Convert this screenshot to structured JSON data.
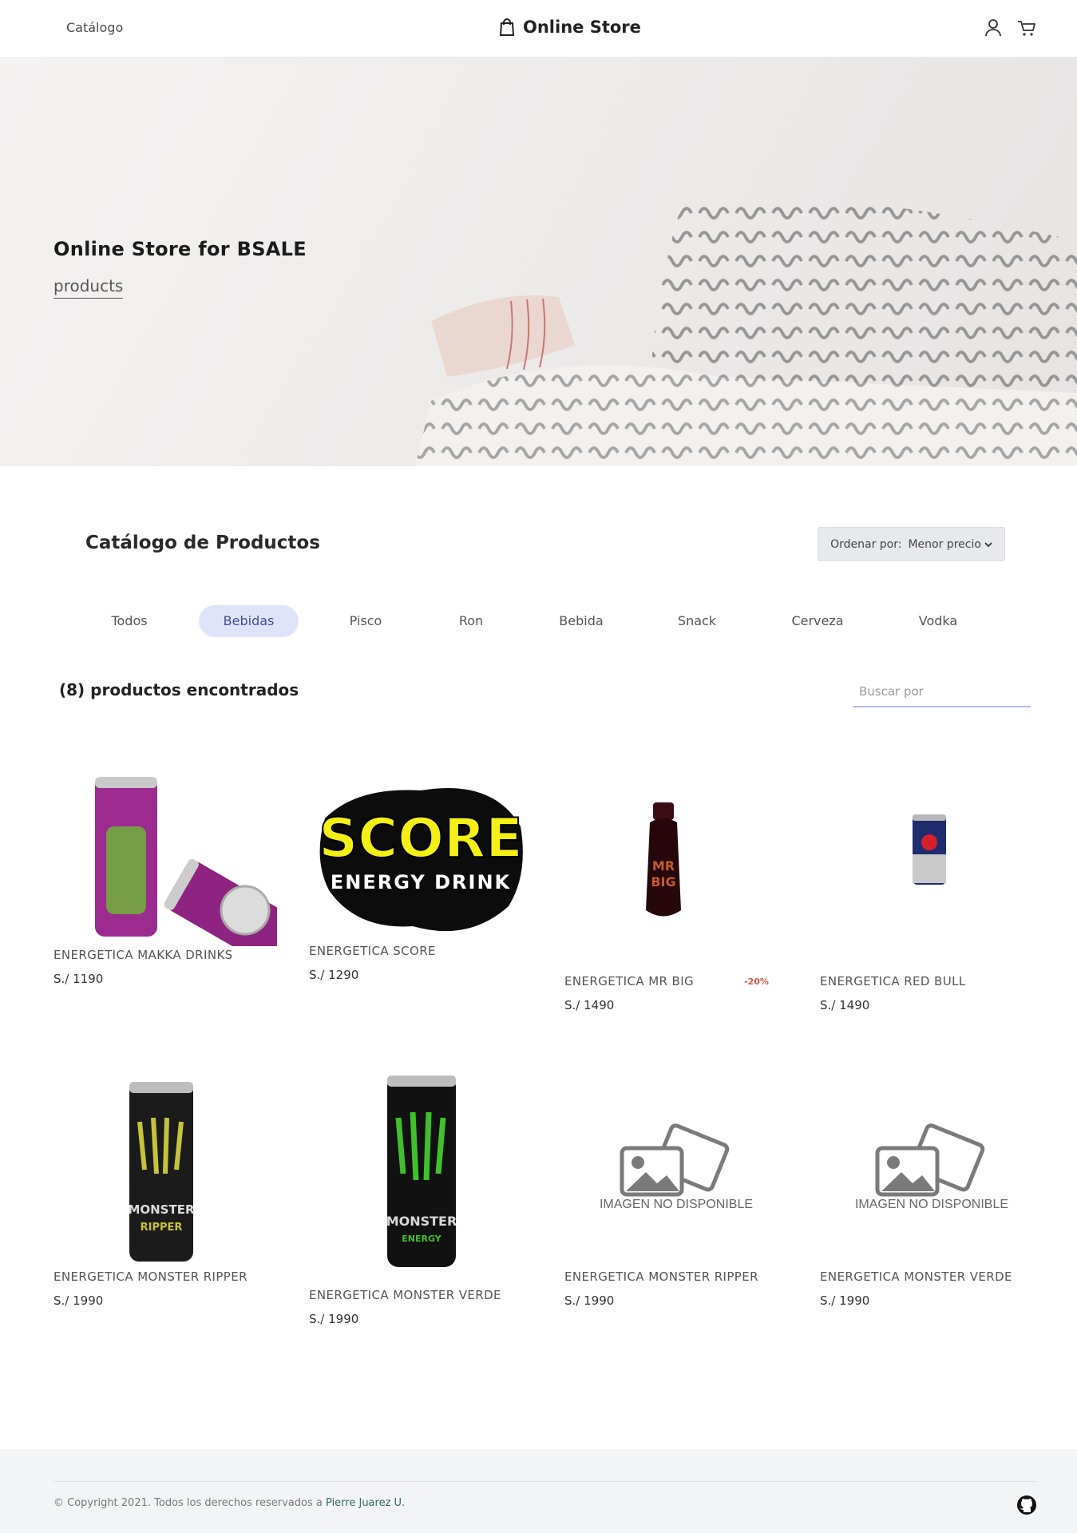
{
  "header": {
    "nav_catalog": "Catálogo",
    "brand": "Online Store",
    "icons": [
      "user-icon",
      "cart-icon"
    ]
  },
  "hero": {
    "title": "Online Store for BSALE",
    "link": "products"
  },
  "catalog": {
    "title": "Catálogo de Productos",
    "sort_label": "Ordenar por:",
    "sort_value": "Menor precio",
    "tabs": [
      "Todos",
      "Bebidas",
      "Pisco",
      "Ron",
      "Bebida",
      "Snack",
      "Cerveza",
      "Vodka"
    ],
    "active_tab": "Bebidas",
    "count_text": "(8) productos encontrados",
    "search_placeholder": "Buscar por"
  },
  "products": [
    {
      "name": "ENERGETICA MAKKA DRINKS",
      "price": "S./ 1190",
      "image": "makka-drinks-can"
    },
    {
      "name": "ENERGETICA SCORE",
      "price": "S./ 1290",
      "image": "score-energy-logo"
    },
    {
      "name": "ENERGETICA MR BIG",
      "price": "S./ 1490",
      "badge": "-20%",
      "image": "mr-big-bottle"
    },
    {
      "name": "ENERGETICA RED BULL",
      "price": "S./ 1490",
      "image": "red-bull-can"
    },
    {
      "name": "ENERGETICA MONSTER RIPPER",
      "price": "S./ 1990",
      "image": "monster-ripper-can"
    },
    {
      "name": "ENERGETICA MONSTER VERDE",
      "price": "S./ 1990",
      "image": "monster-green-can"
    },
    {
      "name": "ENERGETICA MONSTER RIPPER",
      "price": "S./ 1990",
      "image": "image-unavailable",
      "image_text": "IMAGEN NO DISPONIBLE"
    },
    {
      "name": "ENERGETICA MONSTER VERDE",
      "price": "S./ 1990",
      "image": "image-unavailable",
      "image_text": "IMAGEN NO DISPONIBLE"
    }
  ],
  "footer": {
    "copyright": "© Copyright 2021. Todos los derechos reservados a",
    "author": "Pierre Juarez U.",
    "icon": "github-icon"
  },
  "colors": {
    "accent": "#3f4a9c",
    "active_tab_bg": "#e0e4fb",
    "discount": "#e2554b",
    "footer_bg": "#f3f4f6"
  }
}
